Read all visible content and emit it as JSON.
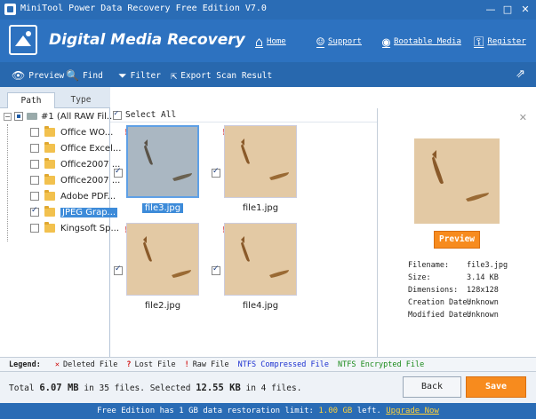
{
  "window": {
    "title": "MiniTool Power Data Recovery Free Edition V7.0",
    "minimize": "—",
    "maximize": "□",
    "close": "✕"
  },
  "header": {
    "product": "Digital Media Recovery",
    "links": [
      {
        "label": "Home",
        "icon": "home-icon"
      },
      {
        "label": "Support",
        "icon": "support-icon"
      },
      {
        "label": "Bootable Media",
        "icon": "disc-icon"
      },
      {
        "label": "Register",
        "icon": "key-icon"
      }
    ]
  },
  "toolbar": {
    "preview": "Preview",
    "find": "Find",
    "filter": "Filter",
    "export": "Export Scan Result"
  },
  "tabs": {
    "path": "Path",
    "type": "Type"
  },
  "tree": {
    "root": "#1 (All RAW Fil...",
    "items": [
      {
        "label": "Office WO...",
        "checked": false
      },
      {
        "label": "Office Excel...",
        "checked": false
      },
      {
        "label": "Office2007 ...",
        "checked": false
      },
      {
        "label": "Office2007 ...",
        "checked": false
      },
      {
        "label": "Adobe PDF...",
        "checked": false
      },
      {
        "label": "JPEG Grap...",
        "checked": true
      },
      {
        "label": "Kingsoft Sp...",
        "checked": false
      }
    ]
  },
  "files": {
    "select_all": "Select All",
    "items": [
      {
        "name": "file3.jpg",
        "selected": true
      },
      {
        "name": "file1.jpg",
        "selected": false
      },
      {
        "name": "file2.jpg",
        "selected": false
      },
      {
        "name": "file4.jpg",
        "selected": false
      }
    ]
  },
  "preview": {
    "button": "Preview",
    "close": "✕",
    "details": [
      {
        "key": "Filename:",
        "value": "file3.jpg"
      },
      {
        "key": "Size:",
        "value": "3.14 KB"
      },
      {
        "key": "Dimensions:",
        "value": "128x128"
      },
      {
        "key": "Creation Date:",
        "value": "Unknown"
      },
      {
        "key": "Modified Date:",
        "value": "Unknown"
      }
    ]
  },
  "legend": {
    "title": "Legend:",
    "deleted": "Deleted File",
    "lost": "Lost File",
    "raw": "Raw File",
    "ntfs_compressed": "NTFS Compressed File",
    "ntfs_encrypted": "NTFS Encrypted File",
    "colors": {
      "deleted": "#d01010",
      "lost": "#d01010",
      "raw": "#d01010",
      "compressed": "#1a2fd0",
      "encrypted": "#1a8a1a"
    }
  },
  "footer": {
    "total_prefix": "Total",
    "total_size": "6.07 MB",
    "total_mid": "in 35 files. Selected",
    "selected_size": "12.55 KB",
    "selected_suffix": "in 4 files.",
    "back": "Back",
    "save": "Save"
  },
  "status": {
    "prefix": "Free Edition has 1 GB data restoration limit:",
    "remaining": "1.00 GB",
    "suffix": "left.",
    "upgrade": "Upgrade Now"
  },
  "colors": {
    "accent": "#2d72c0",
    "orange": "#f78b1e",
    "selection": "#3d8bd9"
  }
}
